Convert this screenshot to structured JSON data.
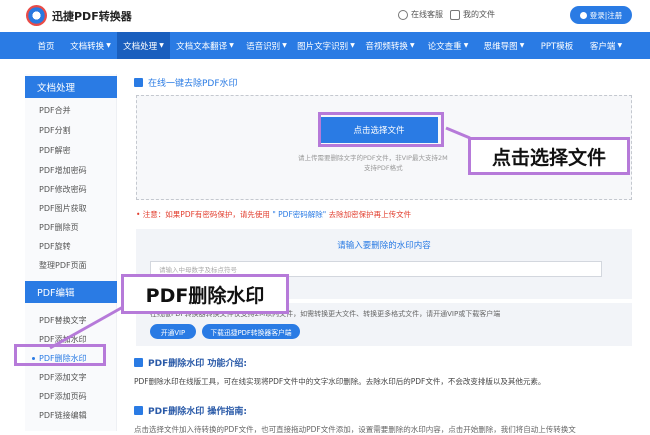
{
  "header": {
    "app_name": "迅捷PDF转换器",
    "online_service": "在线客服",
    "my_files": "我的文件",
    "login": "登录|注册"
  },
  "nav": {
    "items": [
      {
        "label": "首页",
        "caret": ""
      },
      {
        "label": "文档转换",
        "caret": "▼"
      },
      {
        "label": "文档处理",
        "caret": "▼"
      },
      {
        "label": "文档文本翻译",
        "caret": "▼"
      },
      {
        "label": "语音识别",
        "caret": "▼"
      },
      {
        "label": "图片文字识别",
        "caret": "▼"
      },
      {
        "label": "音视频转换",
        "caret": "▼"
      },
      {
        "label": "论文查重",
        "caret": "▼"
      },
      {
        "label": "思维导图",
        "caret": "▼"
      },
      {
        "label": "PPT模板",
        "caret": ""
      },
      {
        "label": "客户端",
        "caret": "▼"
      }
    ]
  },
  "sidebar": {
    "section1_title": "文档处理",
    "section1_items": [
      "PDF合并",
      "PDF分割",
      "PDF解密",
      "PDF增加密码",
      "PDF修改密码",
      "PDF图片获取",
      "PDF删除页",
      "PDF旋转",
      "整理PDF页面"
    ],
    "section2_title": "PDF编辑",
    "section2_items": [
      "PDF替换文字",
      "PDF添加水印",
      "PDF删除水印",
      "PDF添加文字",
      "PDF添加页码",
      "PDF链接编辑"
    ]
  },
  "main": {
    "tool_title": "在线一键去除PDF水印",
    "upload_button": "点击选择文件",
    "upload_hint_line1": "请上传需要删除文字的PDF文件，非VIP最大支持2M",
    "upload_hint_line2": "支持PDF格式",
    "notice_prefix": "• 注意：如果PDF有密码保护，请先使用",
    "notice_link": "\" PDF密码解除\"",
    "notice_suffix": "去除加密保护再上传文件",
    "watermark_label": "请输入要删除的水印内容",
    "watermark_placeholder": "请输入中母数字及标点符号",
    "info_text": "在线版PDF转换器转换文件仅支持2M以内文件，如需转换更大文件、转换更多格式文件，请开通VIP或下载客户端",
    "vip_button": "开通VIP",
    "download_button": "下载迅捷PDF转换器客户端",
    "intro_title": "PDF删除水印 功能介绍:",
    "intro_text": "PDF删除水印在线版工具，可在线实现将PDF文件中的文字水印删除。去除水印后的PDF文件，不会改变排版以及其他元素。",
    "guide_title": "PDF删除水印 操作指南:",
    "guide_text": "点击选择文件加入待转换的PDF文件，也可直接拖动PDF文件添加，设置需要删除的水印内容，点击开始删除，我们将自动上传转换文"
  },
  "annotations": {
    "callout_select_file": "点击选择文件",
    "callout_remove_watermark": "PDF删除水印",
    "highlight_color": "#b67ad9"
  },
  "colors": {
    "brand_blue": "#2a7be4",
    "nav_active": "#1a5fbe",
    "notice_red": "#e23d2d"
  }
}
